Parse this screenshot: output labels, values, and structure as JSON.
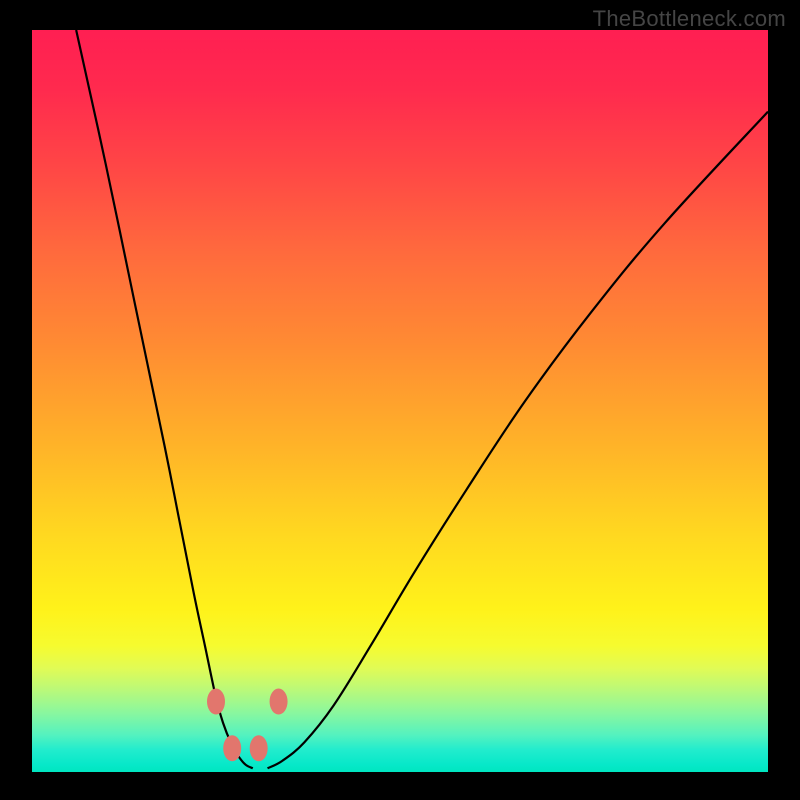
{
  "watermark": "TheBottleneck.com",
  "chart_data": {
    "type": "line",
    "title": "",
    "xlabel": "",
    "ylabel": "",
    "xlim": [
      0,
      100
    ],
    "ylim": [
      0,
      100
    ],
    "note": "Axis values estimated from curve geometry; no tick labels present in image.",
    "series": [
      {
        "name": "left-branch",
        "x": [
          6,
          10,
          14,
          18,
          20,
          22,
          23.5,
          25,
          26,
          27,
          28,
          29,
          30
        ],
        "y": [
          100,
          82,
          63,
          44,
          34,
          24,
          17,
          10,
          6.5,
          4,
          2.2,
          1,
          0.5
        ]
      },
      {
        "name": "right-branch",
        "x": [
          32,
          34,
          37,
          41,
          46,
          52,
          59,
          67,
          76,
          86,
          100
        ],
        "y": [
          0.5,
          1.5,
          4,
          9,
          17,
          27,
          38,
          50,
          62,
          74,
          89
        ]
      }
    ],
    "markers": [
      {
        "name": "left-outer-dot",
        "x": 25.0,
        "y": 9.5
      },
      {
        "name": "right-outer-dot",
        "x": 33.5,
        "y": 9.5
      },
      {
        "name": "left-inner-dot",
        "x": 27.2,
        "y": 3.2
      },
      {
        "name": "right-inner-dot",
        "x": 30.8,
        "y": 3.2
      }
    ],
    "gradient_stops": [
      {
        "pos": 0,
        "color": "#ff1f52"
      },
      {
        "pos": 50,
        "color": "#ffb029"
      },
      {
        "pos": 80,
        "color": "#fff21a"
      },
      {
        "pos": 100,
        "color": "#00e6c0"
      }
    ]
  }
}
